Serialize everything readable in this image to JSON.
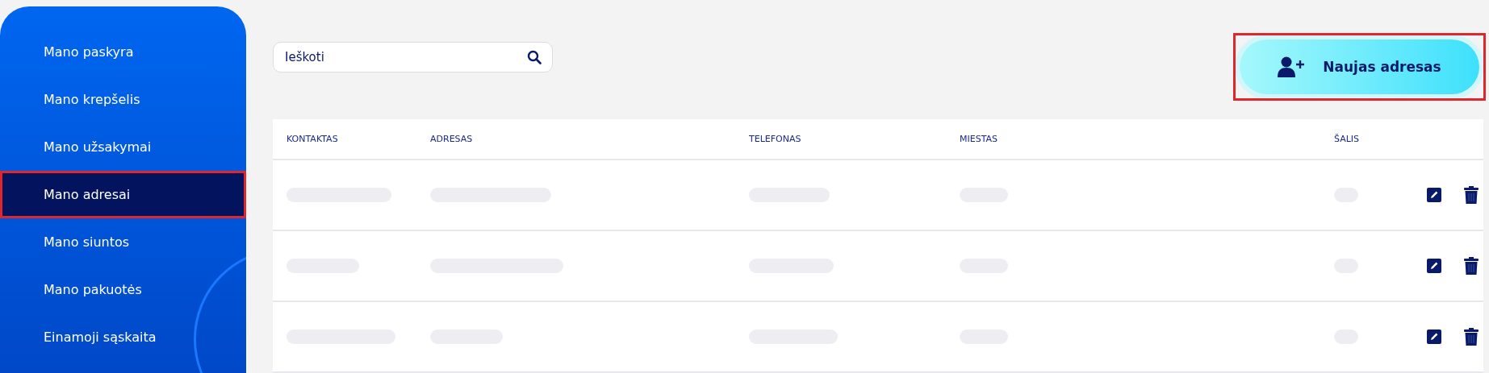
{
  "sidebar": {
    "items": [
      {
        "label": "Mano paskyra",
        "selected": false,
        "highlighted": false
      },
      {
        "label": "Mano krepšelis",
        "selected": false,
        "highlighted": false
      },
      {
        "label": "Mano užsakymai",
        "selected": false,
        "highlighted": false
      },
      {
        "label": "Mano adresai",
        "selected": true,
        "highlighted": true
      },
      {
        "label": "Mano siuntos",
        "selected": false,
        "highlighted": false
      },
      {
        "label": "Mano pakuotės",
        "selected": false,
        "highlighted": false
      },
      {
        "label": "Einamoji sąskaita",
        "selected": false,
        "highlighted": false
      }
    ]
  },
  "search": {
    "placeholder": "Ieškoti"
  },
  "new_button": {
    "label": "Naujas adresas",
    "highlighted": true
  },
  "table": {
    "columns": [
      "KONTAKTAS",
      "ADRESAS",
      "TELEFONAS",
      "MIESTAS",
      "ŠALIS"
    ],
    "rows": [
      {
        "kind": "redacted"
      },
      {
        "kind": "redacted"
      },
      {
        "kind": "redacted"
      }
    ]
  }
}
